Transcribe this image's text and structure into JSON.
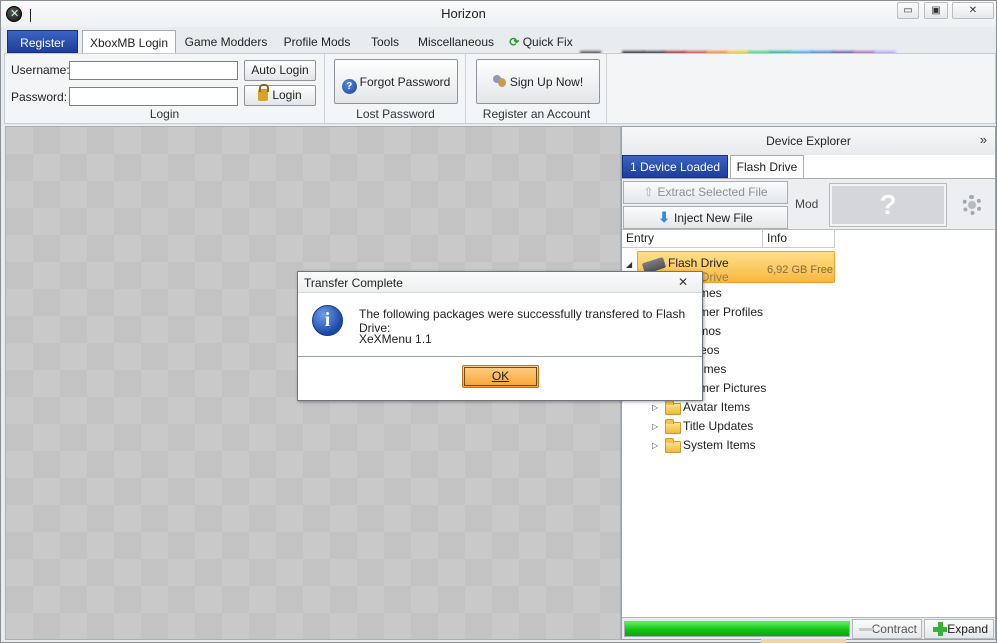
{
  "window": {
    "title": "Horizon"
  },
  "window_controls": {
    "minimize": "▭",
    "maximize": "▣",
    "close": "✕"
  },
  "tabs": [
    {
      "label": "Register"
    },
    {
      "label": "XboxMB Login"
    },
    {
      "label": "Game Modders"
    },
    {
      "label": "Profile Mods"
    },
    {
      "label": "Tools"
    },
    {
      "label": "Miscellaneous"
    },
    {
      "label": "Quick Fix",
      "icon": "refresh-icon"
    }
  ],
  "swatches": [
    "#3a3a3a",
    "#f0f0f0",
    "#151515",
    "#1c1c1c",
    "#8a1a1a",
    "#c0392b",
    "#e67e22",
    "#f1c40f",
    "#2ecc71",
    "#16a085",
    "#3498db",
    "#2979c9",
    "#5b3fa0",
    "#9b59b6",
    "#a0a0ff"
  ],
  "ribbon": {
    "login": {
      "username_label": "Username:",
      "username_value": "",
      "password_label": "Password:",
      "password_value": "",
      "auto_login_label": "Auto Login",
      "login_label": "Login",
      "caption": "Login"
    },
    "lost_password": {
      "button_label": "Forgot Password",
      "caption": "Lost Password"
    },
    "register_account": {
      "button_label": "Sign Up Now!",
      "caption": "Register an Account"
    }
  },
  "device_explorer": {
    "title": "Device Explorer",
    "collapse_glyph": "»",
    "tabs": [
      {
        "label": "1 Device Loaded"
      },
      {
        "label": "Flash Drive"
      }
    ],
    "extract_label": "Extract Selected File",
    "inject_label": "Inject New File",
    "mod_label": "Mod",
    "mod_placeholder": "?",
    "columns": {
      "entry": "Entry",
      "info": "Info"
    },
    "device": {
      "name": "Flash Drive",
      "subtitle": "Flash Drive",
      "info": "6,92 GB Free"
    },
    "tree_items": [
      {
        "label": "Games"
      },
      {
        "label": "Gamer Profiles"
      },
      {
        "label": "Demos"
      },
      {
        "label": "Videos"
      },
      {
        "label": "Themes"
      },
      {
        "label": "Gamer Pictures"
      },
      {
        "label": "Avatar Items"
      },
      {
        "label": "Title Updates"
      },
      {
        "label": "System Items"
      }
    ],
    "footer": {
      "progress": 1.0,
      "contract_label": "Contract",
      "expand_label": "Expand"
    }
  },
  "dialog": {
    "title": "Transfer Complete",
    "close_glyph": "✕",
    "message": "The following packages were successfully transfered to Flash Drive:",
    "package": "XeXMenu 1.1",
    "ok_label": "OK",
    "icon": "info-icon"
  },
  "colors": {
    "accent_tab": "#1e3e99",
    "selection": "#f8b83e",
    "progress": "#13c213",
    "ok_button": "#f7a330"
  }
}
